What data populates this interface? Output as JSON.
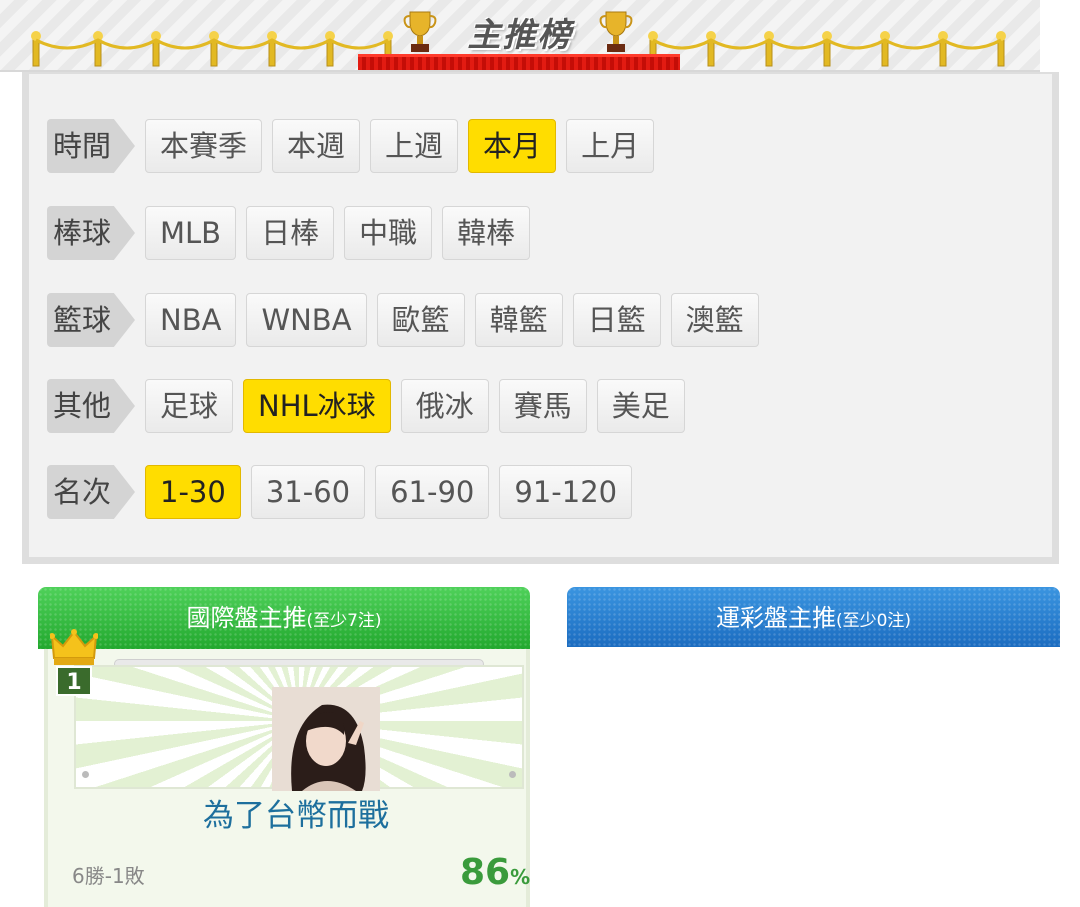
{
  "header": {
    "title": "主推榜"
  },
  "filters": [
    {
      "label": "時間",
      "options": [
        "本賽季",
        "本週",
        "上週",
        "本月",
        "上月"
      ],
      "active": "本月"
    },
    {
      "label": "棒球",
      "options": [
        "MLB",
        "日棒",
        "中職",
        "韓棒"
      ],
      "active": null
    },
    {
      "label": "籃球",
      "options": [
        "NBA",
        "WNBA",
        "歐籃",
        "韓籃",
        "日籃",
        "澳籃"
      ],
      "active": null
    },
    {
      "label": "其他",
      "options": [
        "足球",
        "NHL冰球",
        "俄冰",
        "賽馬",
        "美足"
      ],
      "active": "NHL冰球"
    },
    {
      "label": "名次",
      "options": [
        "1-30",
        "31-60",
        "61-90",
        "91-120"
      ],
      "active": "1-30"
    }
  ],
  "tabs": {
    "intl": {
      "label": "國際盤主推",
      "note": "(至少7注)"
    },
    "lottery": {
      "label": "運彩盤主推",
      "note": "(至少0注)"
    }
  },
  "ranking": [
    {
      "rank": "1",
      "name": "為了台幣而戰",
      "record": "6勝-1敗",
      "win_rate": "86",
      "win_rate_unit": "%"
    }
  ],
  "colors": {
    "active_chip": "#ffdd00",
    "intl_tab": "#2fb43a",
    "lottery_tab": "#2a7fd0",
    "player_name": "#1d6f9d",
    "win_rate": "#3a9b3c"
  }
}
